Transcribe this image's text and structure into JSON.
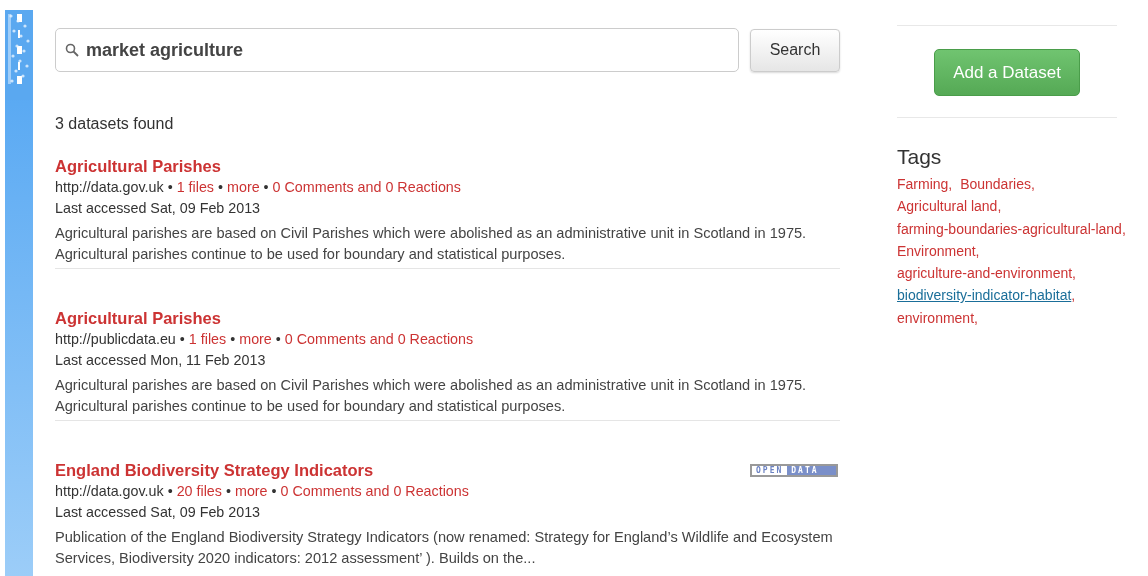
{
  "search": {
    "value": "market agriculture",
    "button": "Search"
  },
  "result_count": "3 datasets found",
  "results": [
    {
      "title": "Agricultural Parishes",
      "meta": [
        {
          "kind": "text",
          "text": "http://data.gov.uk"
        },
        {
          "kind": "sep",
          "text": "•"
        },
        {
          "kind": "link",
          "text": "1 files"
        },
        {
          "kind": "sep",
          "text": "•"
        },
        {
          "kind": "link",
          "text": "more"
        },
        {
          "kind": "sep",
          "text": "•"
        },
        {
          "kind": "link",
          "text": "0 Comments and 0 Reactions"
        }
      ],
      "accessed": "Last accessed Sat, 09 Feb 2013",
      "description": "Agricultural parishes are based on Civil Parishes which were abolished as an administrative unit in Scotland in 1975. Agricultural parishes continue to be used for boundary and statistical purposes.",
      "divider": true
    },
    {
      "title": "Agricultural Parishes",
      "meta": [
        {
          "kind": "text",
          "text": "http://publicdata.eu"
        },
        {
          "kind": "sep",
          "text": "•"
        },
        {
          "kind": "link",
          "text": "1 files"
        },
        {
          "kind": "sep",
          "text": "•"
        },
        {
          "kind": "link",
          "text": "more"
        },
        {
          "kind": "sep",
          "text": "•"
        },
        {
          "kind": "link",
          "text": "0 Comments and 0 Reactions"
        }
      ],
      "accessed": "Last accessed Mon, 11 Feb 2013",
      "description": "Agricultural parishes are based on Civil Parishes which were abolished as an administrative unit in Scotland in 1975. Agricultural parishes continue to be used for boundary and statistical purposes.",
      "divider": true
    },
    {
      "title": "England Biodiversity Strategy Indicators",
      "badge": {
        "left": "OPEN",
        "right": "DATA"
      },
      "meta": [
        {
          "kind": "text",
          "text": "http://data.gov.uk"
        },
        {
          "kind": "sep",
          "text": "•"
        },
        {
          "kind": "link",
          "text": "20 files"
        },
        {
          "kind": "sep",
          "text": "•"
        },
        {
          "kind": "link",
          "text": "more"
        },
        {
          "kind": "sep",
          "text": "•"
        },
        {
          "kind": "link",
          "text": "0 Comments and 0 Reactions"
        }
      ],
      "accessed": "Last accessed Sat, 09 Feb 2013",
      "description": "Publication of the England Biodiversity Strategy Indicators (now renamed: Strategy for England’s Wildlife and Ecosystem Services, Biodiversity 2020 indicators: 2012 assessment’ ). Builds on the...",
      "divider": false
    }
  ],
  "sidebar": {
    "add_button": "Add a Dataset",
    "tags_heading": "Tags",
    "tags": [
      {
        "label": "Farming",
        "separator": ",",
        "hovered": false
      },
      {
        "label": "Boundaries",
        "separator": ",",
        "hovered": false
      },
      {
        "label": "Agricultural land",
        "separator": ",",
        "hovered": false
      },
      {
        "label": "farming-boundaries-agricultural-land",
        "separator": ",",
        "hovered": false
      },
      {
        "label": "Environment",
        "separator": ",",
        "hovered": false
      },
      {
        "label": "agriculture-and-environment",
        "separator": ",",
        "hovered": false
      },
      {
        "label": "biodiversity-indicator-habitat",
        "separator": ",",
        "hovered": true
      },
      {
        "label": "environment",
        "separator": ",",
        "hovered": false
      }
    ]
  }
}
